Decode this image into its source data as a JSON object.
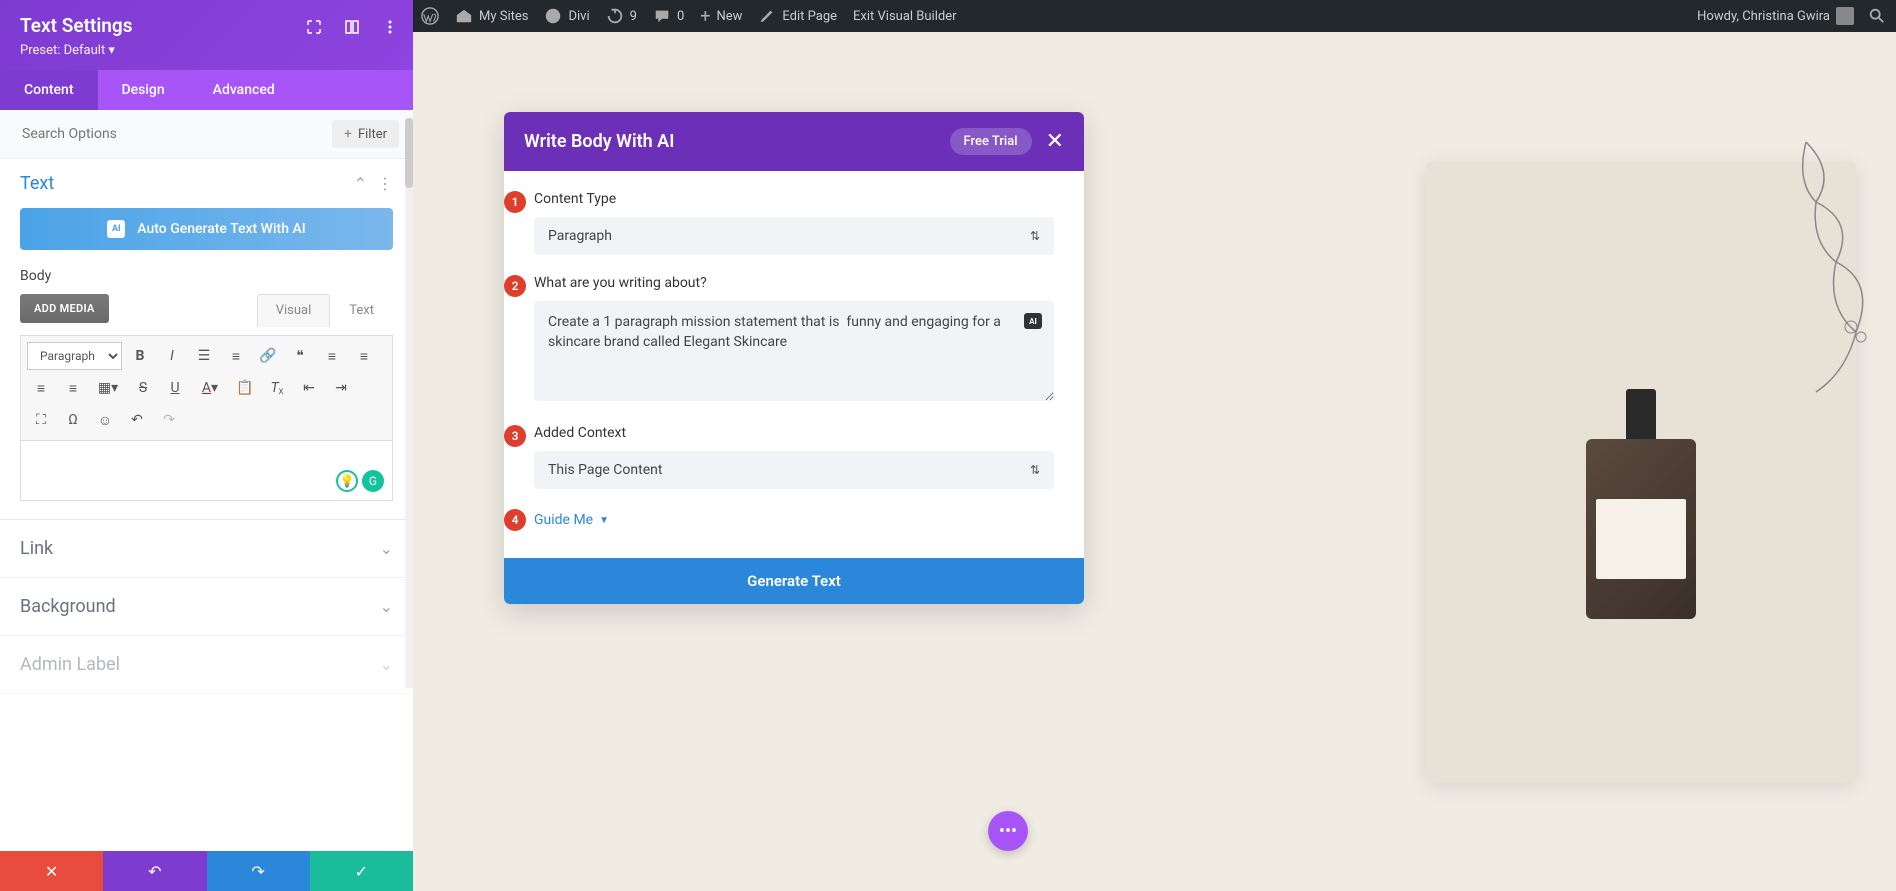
{
  "wpbar": {
    "mysites": "My Sites",
    "divi": "Divi",
    "updates": "9",
    "comments": "0",
    "new": "New",
    "edit": "Edit Page",
    "exit": "Exit Visual Builder",
    "howdy": "Howdy, Christina Gwira"
  },
  "panel": {
    "title": "Text Settings",
    "preset": "Preset: Default ▾",
    "tabs": {
      "content": "Content",
      "design": "Design",
      "advanced": "Advanced"
    },
    "search_placeholder": "Search Options",
    "filter": "Filter"
  },
  "text_section": {
    "title": "Text",
    "ai_btn": "Auto Generate Text With AI",
    "body_label": "Body",
    "add_media": "ADD MEDIA",
    "editor_tabs": {
      "visual": "Visual",
      "text": "Text"
    },
    "format": "Paragraph"
  },
  "collapsed": {
    "link": "Link",
    "background": "Background",
    "admin": "Admin Label"
  },
  "ai_modal": {
    "title": "Write Body With AI",
    "trial": "Free Trial",
    "close": "✕",
    "steps": {
      "s1": "1",
      "s2": "2",
      "s3": "3",
      "s4": "4"
    },
    "content_type_label": "Content Type",
    "content_type_value": "Paragraph",
    "prompt_label": "What are you writing about?",
    "prompt_value": "Create a 1 paragraph mission statement that is  funny and engaging for a skincare brand called Elegant Skincare",
    "context_label": "Added Context",
    "context_value": "This Page Content",
    "guide": "Guide Me",
    "generate": "Generate Text"
  }
}
